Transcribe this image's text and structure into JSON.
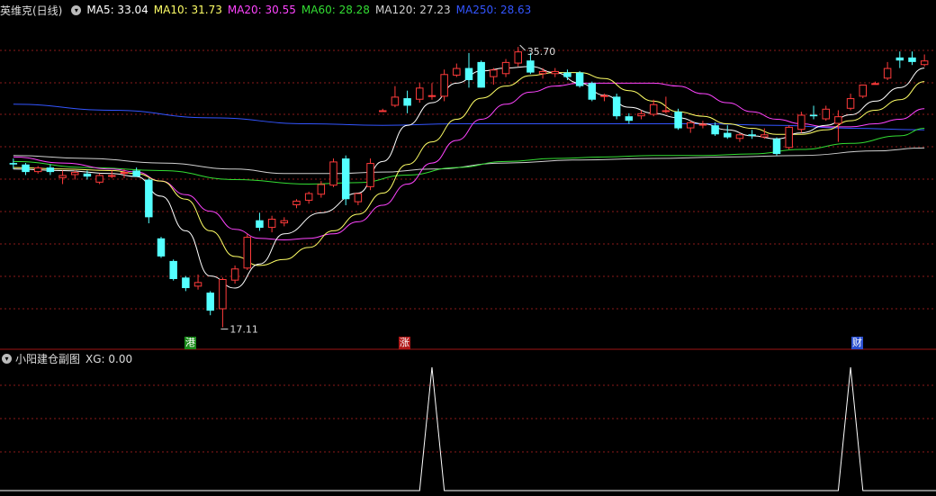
{
  "header": {
    "stock_title": "英维克(日线)",
    "ma5": "MA5: 33.04",
    "ma10": "MA10: 31.73",
    "ma20": "MA20: 30.55",
    "ma60": "MA60: 28.28",
    "ma120": "MA120: 27.23",
    "ma250": "MA250: 28.63"
  },
  "sub_panel": {
    "title": "小阳建仓副图",
    "xg_label": "XG: 0.00"
  },
  "tags": [
    {
      "text": "港",
      "color": "#1a8a1a"
    },
    {
      "text": "涨",
      "color": "#b01818"
    },
    {
      "text": "财",
      "color": "#2a4fd0"
    }
  ],
  "colors": {
    "up": "#ff3b3b",
    "down": "#54ffff",
    "ma5": "#ffffff",
    "ma10": "#ffff66",
    "ma20": "#ff44ff",
    "ma60": "#33dd33",
    "ma120": "#d0d0d0",
    "ma250": "#3355ff",
    "grid": "#8b1a1a",
    "separator": "#a01515"
  },
  "chart_data": {
    "type": "candlestick",
    "y_range": [
      16.0,
      37.5
    ],
    "high_annotation": "35.70",
    "low_annotation": "17.11",
    "candles": [
      [
        28.0,
        28.3,
        27.6,
        27.9
      ],
      [
        27.9,
        28.0,
        27.2,
        27.4
      ],
      [
        27.4,
        27.8,
        27.3,
        27.7
      ],
      [
        27.7,
        27.9,
        27.2,
        27.4
      ],
      [
        27.0,
        27.5,
        26.6,
        27.2
      ],
      [
        27.2,
        27.5,
        26.9,
        27.4
      ],
      [
        27.3,
        27.5,
        26.9,
        27.1
      ],
      [
        26.7,
        27.3,
        26.6,
        27.2
      ],
      [
        27.2,
        27.5,
        27.0,
        27.2
      ],
      [
        27.3,
        27.6,
        27.0,
        27.4
      ],
      [
        27.5,
        27.7,
        27.1,
        27.1
      ],
      [
        26.9,
        27.0,
        24.0,
        24.4
      ],
      [
        23.0,
        23.1,
        21.7,
        21.8
      ],
      [
        21.5,
        21.6,
        20.2,
        20.3
      ],
      [
        20.4,
        20.5,
        19.5,
        19.7
      ],
      [
        19.8,
        20.6,
        19.6,
        20.1
      ],
      [
        19.4,
        19.5,
        17.9,
        18.2
      ],
      [
        18.3,
        20.4,
        17.1,
        20.3
      ],
      [
        20.2,
        21.2,
        20.0,
        21.0
      ],
      [
        21.0,
        23.3,
        20.9,
        23.1
      ],
      [
        24.2,
        24.7,
        23.5,
        23.7
      ],
      [
        23.7,
        24.5,
        23.4,
        24.3
      ],
      [
        24.0,
        24.4,
        23.8,
        24.2
      ],
      [
        25.2,
        25.6,
        25.0,
        25.5
      ],
      [
        25.5,
        26.1,
        25.3,
        26.0
      ],
      [
        25.9,
        26.8,
        25.7,
        26.6
      ],
      [
        26.5,
        28.3,
        26.4,
        28.1
      ],
      [
        28.3,
        28.5,
        25.2,
        25.6
      ],
      [
        25.4,
        26.0,
        25.2,
        26.0
      ],
      [
        26.4,
        28.3,
        26.2,
        28.0
      ],
      [
        31.5,
        31.6,
        31.4,
        31.5
      ],
      [
        31.8,
        33.1,
        31.7,
        32.4
      ],
      [
        32.3,
        32.8,
        31.3,
        31.8
      ],
      [
        32.2,
        33.3,
        32.0,
        33.0
      ],
      [
        32.4,
        33.3,
        32.2,
        32.5
      ],
      [
        32.4,
        34.2,
        32.1,
        33.9
      ],
      [
        33.8,
        34.6,
        33.7,
        34.3
      ],
      [
        34.3,
        35.3,
        33.0,
        33.5
      ],
      [
        34.7,
        34.8,
        33.0,
        33.0
      ],
      [
        33.7,
        34.3,
        33.2,
        34.2
      ],
      [
        33.9,
        34.9,
        33.7,
        34.7
      ],
      [
        34.6,
        35.7,
        34.4,
        35.4
      ],
      [
        34.8,
        35.3,
        33.9,
        34.0
      ],
      [
        33.9,
        34.3,
        33.6,
        34.1
      ],
      [
        33.9,
        34.3,
        33.7,
        34.1
      ],
      [
        34.0,
        34.2,
        33.5,
        33.7
      ],
      [
        34.0,
        34.1,
        33.0,
        33.1
      ],
      [
        33.3,
        33.4,
        32.1,
        32.2
      ],
      [
        32.4,
        32.6,
        32.1,
        32.5
      ],
      [
        32.4,
        32.6,
        30.9,
        31.1
      ],
      [
        31.1,
        31.3,
        30.6,
        30.8
      ],
      [
        31.1,
        31.5,
        30.9,
        31.3
      ],
      [
        31.2,
        32.2,
        31.1,
        31.9
      ],
      [
        31.4,
        32.4,
        31.3,
        31.5
      ],
      [
        31.4,
        31.6,
        30.2,
        30.3
      ],
      [
        30.3,
        30.8,
        30.0,
        30.7
      ],
      [
        30.5,
        30.8,
        30.3,
        30.6
      ],
      [
        30.5,
        30.7,
        29.8,
        29.9
      ],
      [
        30.0,
        30.5,
        29.6,
        29.7
      ],
      [
        29.6,
        30.0,
        29.4,
        29.9
      ],
      [
        29.9,
        30.2,
        29.6,
        29.8
      ],
      [
        29.7,
        30.3,
        29.6,
        29.9
      ],
      [
        29.6,
        29.7,
        28.5,
        28.6
      ],
      [
        29.0,
        30.5,
        28.9,
        30.4
      ],
      [
        30.2,
        31.4,
        30.0,
        31.2
      ],
      [
        31.2,
        31.8,
        30.9,
        31.1
      ],
      [
        30.9,
        31.8,
        30.8,
        31.6
      ],
      [
        30.6,
        31.5,
        29.4,
        31.1
      ],
      [
        31.6,
        32.6,
        31.5,
        32.3
      ],
      [
        32.4,
        33.2,
        32.3,
        33.2
      ],
      [
        33.3,
        33.4,
        33.2,
        33.3
      ],
      [
        33.6,
        34.7,
        33.5,
        34.3
      ],
      [
        35.0,
        35.4,
        34.3,
        34.8
      ],
      [
        35.0,
        35.4,
        34.5,
        34.7
      ],
      [
        34.5,
        35.2,
        34.4,
        34.8
      ]
    ],
    "ma_series": {
      "ma5": [
        [
          0,
          27.6
        ],
        [
          4,
          27.5
        ],
        [
          8,
          27.3
        ],
        [
          10,
          27.1
        ],
        [
          12,
          25.8
        ],
        [
          14,
          23.5
        ],
        [
          16,
          20.5
        ],
        [
          18,
          19.7
        ],
        [
          20,
          21.3
        ],
        [
          22,
          23.3
        ],
        [
          25,
          24.7
        ],
        [
          28,
          26.0
        ],
        [
          30,
          28.1
        ],
        [
          32,
          30.5
        ],
        [
          34,
          32.0
        ],
        [
          36,
          33.3
        ],
        [
          38,
          34.1
        ],
        [
          40,
          34.3
        ],
        [
          42,
          34.4
        ],
        [
          44,
          34.0
        ],
        [
          46,
          33.3
        ],
        [
          48,
          32.5
        ],
        [
          50,
          31.7
        ],
        [
          52,
          31.3
        ],
        [
          54,
          31.0
        ],
        [
          56,
          30.6
        ],
        [
          58,
          30.2
        ],
        [
          60,
          29.8
        ],
        [
          62,
          29.6
        ],
        [
          64,
          30.0
        ],
        [
          66,
          30.5
        ],
        [
          68,
          31.2
        ],
        [
          70,
          32.1
        ],
        [
          72,
          33.0
        ],
        [
          74,
          34.3
        ]
      ],
      "ma10": [
        [
          0,
          27.7
        ],
        [
          4,
          27.6
        ],
        [
          8,
          27.5
        ],
        [
          10,
          27.3
        ],
        [
          12,
          26.8
        ],
        [
          14,
          25.6
        ],
        [
          16,
          23.5
        ],
        [
          18,
          21.8
        ],
        [
          20,
          21.2
        ],
        [
          22,
          21.6
        ],
        [
          24,
          22.4
        ],
        [
          26,
          23.5
        ],
        [
          28,
          24.6
        ],
        [
          30,
          26.0
        ],
        [
          32,
          27.9
        ],
        [
          34,
          29.4
        ],
        [
          36,
          30.9
        ],
        [
          38,
          32.3
        ],
        [
          40,
          33.1
        ],
        [
          42,
          33.8
        ],
        [
          44,
          34.0
        ],
        [
          46,
          34.0
        ],
        [
          48,
          33.6
        ],
        [
          50,
          32.8
        ],
        [
          52,
          32.1
        ],
        [
          54,
          31.4
        ],
        [
          56,
          31.1
        ],
        [
          58,
          30.6
        ],
        [
          60,
          30.3
        ],
        [
          62,
          29.9
        ],
        [
          64,
          29.9
        ],
        [
          66,
          30.2
        ],
        [
          68,
          30.8
        ],
        [
          70,
          31.5
        ],
        [
          72,
          32.2
        ],
        [
          74,
          33.4
        ]
      ],
      "ma20": [
        [
          0,
          28.4
        ],
        [
          4,
          28.0
        ],
        [
          8,
          27.6
        ],
        [
          10,
          27.4
        ],
        [
          12,
          26.8
        ],
        [
          14,
          25.9
        ],
        [
          16,
          24.8
        ],
        [
          18,
          23.6
        ],
        [
          20,
          23.0
        ],
        [
          22,
          22.9
        ],
        [
          24,
          23.0
        ],
        [
          26,
          23.3
        ],
        [
          28,
          24.1
        ],
        [
          30,
          25.2
        ],
        [
          32,
          26.6
        ],
        [
          34,
          28.0
        ],
        [
          36,
          29.5
        ],
        [
          38,
          30.9
        ],
        [
          40,
          31.9
        ],
        [
          42,
          32.7
        ],
        [
          44,
          33.1
        ],
        [
          46,
          33.3
        ],
        [
          48,
          33.3
        ],
        [
          50,
          33.3
        ],
        [
          52,
          33.3
        ],
        [
          54,
          33.1
        ],
        [
          56,
          32.6
        ],
        [
          58,
          32.0
        ],
        [
          60,
          31.4
        ],
        [
          62,
          30.9
        ],
        [
          64,
          30.6
        ],
        [
          66,
          30.4
        ],
        [
          68,
          30.4
        ],
        [
          70,
          30.6
        ],
        [
          72,
          30.9
        ],
        [
          74,
          31.6
        ]
      ],
      "ma60": [
        [
          0,
          28.1
        ],
        [
          6,
          27.7
        ],
        [
          12,
          27.5
        ],
        [
          18,
          26.9
        ],
        [
          24,
          26.6
        ],
        [
          28,
          26.7
        ],
        [
          32,
          27.2
        ],
        [
          36,
          27.7
        ],
        [
          40,
          28.1
        ],
        [
          44,
          28.3
        ],
        [
          48,
          28.4
        ],
        [
          52,
          28.5
        ],
        [
          56,
          28.5
        ],
        [
          60,
          28.6
        ],
        [
          64,
          28.9
        ],
        [
          68,
          29.3
        ],
        [
          72,
          29.8
        ],
        [
          74,
          30.3
        ]
      ],
      "ma120": [
        [
          0,
          28.5
        ],
        [
          6,
          28.3
        ],
        [
          12,
          28.0
        ],
        [
          18,
          27.6
        ],
        [
          22,
          27.3
        ],
        [
          26,
          27.3
        ],
        [
          30,
          27.4
        ],
        [
          34,
          27.6
        ],
        [
          40,
          28.0
        ],
        [
          46,
          28.2
        ],
        [
          52,
          28.3
        ],
        [
          58,
          28.4
        ],
        [
          64,
          28.5
        ],
        [
          70,
          28.8
        ],
        [
          74,
          29.0
        ]
      ],
      "ma250": [
        [
          0,
          31.9
        ],
        [
          8,
          31.5
        ],
        [
          16,
          31.0
        ],
        [
          24,
          30.6
        ],
        [
          30,
          30.5
        ],
        [
          36,
          30.6
        ],
        [
          42,
          30.6
        ],
        [
          50,
          30.6
        ],
        [
          56,
          30.6
        ],
        [
          62,
          30.5
        ],
        [
          68,
          30.3
        ],
        [
          74,
          30.2
        ]
      ]
    },
    "signal": {
      "y_range": [
        0,
        1
      ],
      "peaks": [
        34,
        68
      ]
    }
  }
}
